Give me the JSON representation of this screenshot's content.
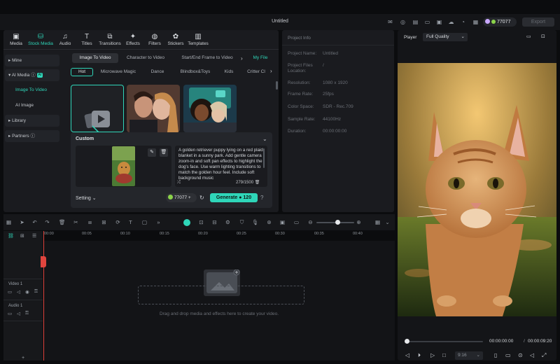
{
  "window": {
    "title": "Untitled"
  },
  "account": {
    "credits": "77077",
    "export_label": "Export"
  },
  "categories": [
    {
      "label": "Media",
      "icon": "media-icon"
    },
    {
      "label": "Stock Media",
      "icon": "stock-media-icon"
    },
    {
      "label": "Audio",
      "icon": "audio-icon"
    },
    {
      "label": "Titles",
      "icon": "titles-icon"
    },
    {
      "label": "Transitions",
      "icon": "transitions-icon"
    },
    {
      "label": "Effects",
      "icon": "effects-icon"
    },
    {
      "label": "Filters",
      "icon": "filters-icon"
    },
    {
      "label": "Stickers",
      "icon": "stickers-icon"
    },
    {
      "label": "Templates",
      "icon": "templates-icon"
    }
  ],
  "sidebar": {
    "mine": "Mine",
    "ai_media": "AI Media",
    "ai_badge": "AI",
    "image_to_video": "Image To Video",
    "ai_image": "AI Image",
    "library": "Library",
    "partners": "Partners"
  },
  "main_tabs": [
    "Image To Video",
    "Character to Video",
    "Start/End Frame to Video"
  ],
  "my_file": "My File",
  "sub_tabs": [
    "Hot",
    "Microwave Magic",
    "Dance",
    "Blindbox&Toys",
    "Kids",
    "Critter Cl"
  ],
  "custom": {
    "label": "Custom",
    "prompt": "A golden retriever puppy lying on a red plaid blanket in a sunny park. Add gentle camera zoom-in and soft pan effects to highlight the dog's face. Use warm lighting transitions to match the golden hour feel. Include soft background music",
    "counter": "279/1500",
    "setting_label": "Setting",
    "credits": "77077",
    "generate_label": "Generate",
    "generate_cost": "120"
  },
  "project_info": {
    "header": "Project Info",
    "rows": [
      {
        "label": "Project Name:",
        "value": "Untitled"
      },
      {
        "label": "Project Files Location:",
        "value": "/"
      },
      {
        "label": "Resolution:",
        "value": "1080 x 1920"
      },
      {
        "label": "Frame Rate:",
        "value": "25fps"
      },
      {
        "label": "Color Space:",
        "value": "SDR - Rec.709"
      },
      {
        "label": "Sample Rate:",
        "value": "44100Hz"
      },
      {
        "label": "Duration:",
        "value": "00:00:00:00"
      }
    ]
  },
  "player": {
    "label": "Player",
    "quality": "Full Quality",
    "current_time": "00:00:00:00",
    "total_time": "00:00:09:20",
    "ratio": "9:16"
  },
  "timeline": {
    "ticks": [
      "00:00",
      "00:05",
      "00:10",
      "00:15",
      "00:20",
      "00:25",
      "00:30",
      "00:35",
      "00:40"
    ],
    "video_track": "Video 1",
    "audio_track": "Audio 1",
    "drop_hint": "Drag and drop media and effects here to create your video."
  },
  "colors": {
    "accent": "#2fd6b9",
    "panel": "#1a1b1f",
    "background": "#0b0c0e",
    "playhead": "#e0453e"
  }
}
